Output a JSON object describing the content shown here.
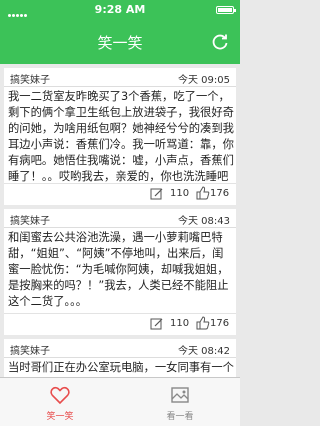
{
  "status_bar": {
    "time": "9:28 AM"
  },
  "nav": {
    "title": "笑一笑",
    "refresh_icon": "refresh-icon"
  },
  "posts": [
    {
      "author": "搞笑妹子",
      "date": "今天 09:05",
      "content": "我一二货室友昨晚买了3个香蕉，吃了一个，剩下的俩个拿卫生纸包上放进袋子，我很好奇的问她，为啥用纸包啊？她神经兮兮的凑到我耳边小声说：香蕉们冷。我一听骂道：靠，你有病吧。她悟住我嘴说：嘘，小声点，香蕉们睡了！。。哎哟我去，亲爱的，你也洗洗睡吧",
      "comments": "110",
      "likes": "176"
    },
    {
      "author": "搞笑妹子",
      "date": "今天 08:43",
      "content": "和闺蜜去公共浴池洗澡，遇一小萝莉嘴巴特甜，“姐姐”、“阿姨”不停地叫，出来后，闺蜜一脸忧伤：“为毛喊你阿姨，却喊我姐姐，是按胸来的吗？！”我去，人类已经不能阻止这个二货了。。。",
      "comments": "110",
      "likes": "176"
    },
    {
      "author": "搞笑妹子",
      "date": "今天 08:42",
      "content": "当时哥们正在办公室玩电脑，一女同事有一个很小的老弟，她这小老弟冲进办公室就翻她姐姐的包包，突然大喊：姐姐有口香糖！",
      "comments": "",
      "likes": ""
    }
  ],
  "tabs": [
    {
      "label": "笑一笑",
      "icon": "heart-icon",
      "active": true
    },
    {
      "label": "看一看",
      "icon": "image-icon",
      "active": false
    }
  ],
  "colors": {
    "brand": "#3cc258",
    "active_tab": "#e84c4c"
  }
}
